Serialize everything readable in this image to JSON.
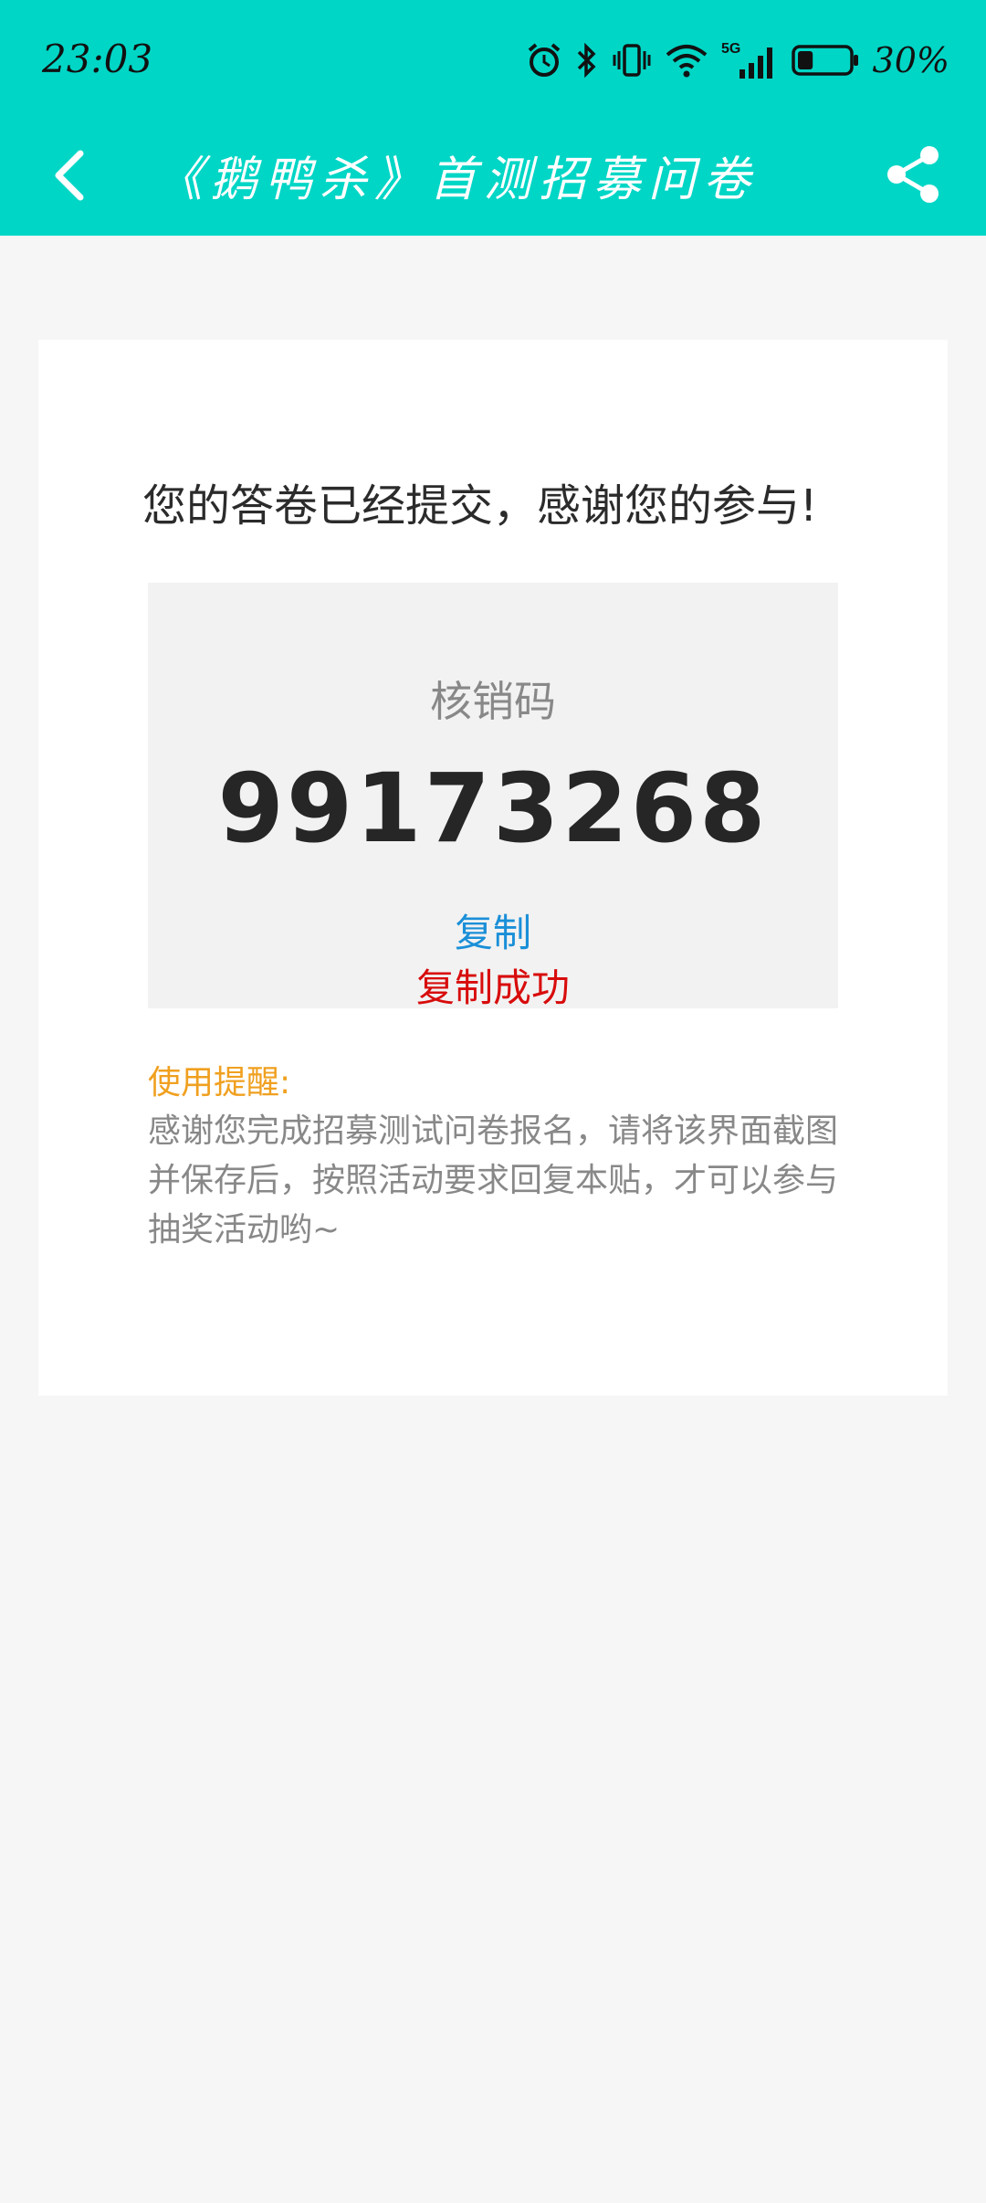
{
  "status_bar": {
    "time": "23:03",
    "network": "5G",
    "battery_percent": "30%",
    "battery_level": 0.3,
    "icons": [
      "alarm-icon",
      "bluetooth-icon",
      "vibrate-icon",
      "wifi-icon",
      "signal-5g-icon",
      "battery-icon"
    ]
  },
  "navbar": {
    "title": "《鹅鸭杀》首测招募问卷",
    "back_icon": "chevron-left-icon",
    "share_icon": "share-icon"
  },
  "result_card": {
    "headline": "您的答卷已经提交，感谢您的参与!",
    "code_label": "核销码",
    "code_value": "99173268",
    "copy_label": "复制",
    "copy_success": "复制成功",
    "tip_title": "使用提醒:",
    "tip_body": "感谢您完成招募测试问卷报名，请将该界面截图并保存后，按照活动要求回复本贴，才可以参与抽奖活动哟~"
  },
  "colors": {
    "header_bg": "#00d6c6",
    "copy_link": "#1a8fd8",
    "copy_success": "#d80c0c",
    "tip_title": "#f0a020"
  }
}
